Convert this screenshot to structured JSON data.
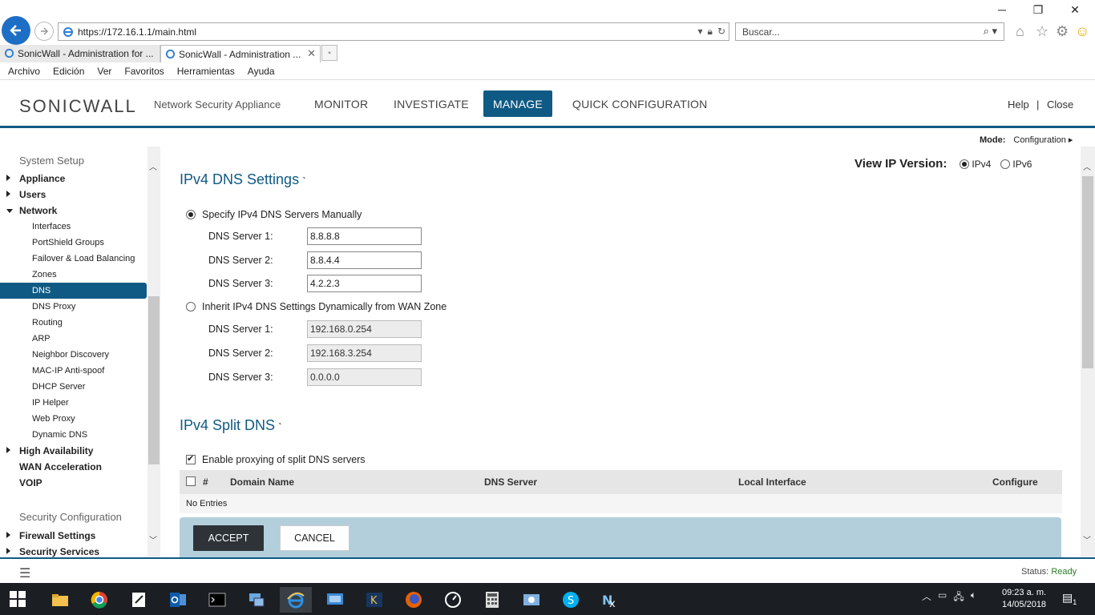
{
  "browser": {
    "url": "https://172.16.1.1/main.html",
    "search_placeholder": "Buscar...",
    "tabs": [
      {
        "label": "SonicWall - Administration for ...",
        "active": false
      },
      {
        "label": "SonicWall - Administration ...",
        "active": true
      }
    ],
    "menu": [
      "Archivo",
      "Edición",
      "Ver",
      "Favoritos",
      "Herramientas",
      "Ayuda"
    ]
  },
  "header": {
    "logo": "SONICWALL",
    "subtitle": "Network Security Appliance",
    "nav": [
      "MONITOR",
      "INVESTIGATE",
      "MANAGE",
      "QUICK CONFIGURATION"
    ],
    "active_nav": "MANAGE",
    "help": "Help",
    "separator": "|",
    "close": "Close",
    "accent_color": "#0f5a84"
  },
  "mode": {
    "label": "Mode:",
    "value": "Configuration"
  },
  "sidebar": {
    "system_setup": "System Setup",
    "items": [
      {
        "label": "Appliance",
        "level": 1,
        "expanded": false
      },
      {
        "label": "Users",
        "level": 1,
        "expanded": false
      },
      {
        "label": "Network",
        "level": 1,
        "expanded": true
      },
      {
        "label": "Interfaces",
        "level": 2
      },
      {
        "label": "PortShield Groups",
        "level": 2
      },
      {
        "label": "Failover & Load Balancing",
        "level": 2
      },
      {
        "label": "Zones",
        "level": 2
      },
      {
        "label": "DNS",
        "level": 2,
        "selected": true
      },
      {
        "label": "DNS Proxy",
        "level": 2
      },
      {
        "label": "Routing",
        "level": 2
      },
      {
        "label": "ARP",
        "level": 2
      },
      {
        "label": "Neighbor Discovery",
        "level": 2
      },
      {
        "label": "MAC-IP Anti-spoof",
        "level": 2
      },
      {
        "label": "DHCP Server",
        "level": 2
      },
      {
        "label": "IP Helper",
        "level": 2
      },
      {
        "label": "Web Proxy",
        "level": 2
      },
      {
        "label": "Dynamic DNS",
        "level": 2
      },
      {
        "label": "High Availability",
        "level": 1,
        "expanded": false
      },
      {
        "label": "WAN Acceleration",
        "level": 1
      },
      {
        "label": "VOIP",
        "level": 1
      }
    ],
    "security_configuration": "Security Configuration",
    "security_items": [
      {
        "label": "Firewall Settings",
        "level": 1,
        "expanded": false
      },
      {
        "label": "Security Services",
        "level": 1,
        "expanded": false
      }
    ]
  },
  "main": {
    "ip_version": {
      "label": "View IP Version:",
      "options": [
        "IPv4",
        "IPv6"
      ],
      "selected": "IPv4"
    },
    "dns_title": "IPv4 DNS Settings",
    "manual_option": "Specify IPv4 DNS Servers Manually",
    "manual_selected": true,
    "manual_servers": [
      {
        "label": "DNS Server 1:",
        "value": "8.8.8.8"
      },
      {
        "label": "DNS Server 2:",
        "value": "8.8.4.4"
      },
      {
        "label": "DNS Server 3:",
        "value": "4.2.2.3"
      }
    ],
    "inherit_option": "Inherit IPv4 DNS Settings Dynamically from WAN Zone",
    "inherit_servers": [
      {
        "label": "DNS Server 1:",
        "value": "192.168.0.254"
      },
      {
        "label": "DNS Server 2:",
        "value": "192.168.3.254"
      },
      {
        "label": "DNS Server 3:",
        "value": "0.0.0.0"
      }
    ],
    "split_title": "IPv4 Split DNS",
    "split_enable": "Enable proxying of split DNS servers",
    "split_enabled": true,
    "table_headers": [
      "#",
      "Domain Name",
      "DNS Server",
      "Local Interface",
      "Configure"
    ],
    "table_empty": "No Entries",
    "accept": "ACCEPT",
    "cancel": "CANCEL"
  },
  "status": {
    "label": "Status:",
    "value": "Ready"
  },
  "taskbar": {
    "time": "09:23 a. m.",
    "date": "14/05/2018",
    "notifications": "1"
  }
}
